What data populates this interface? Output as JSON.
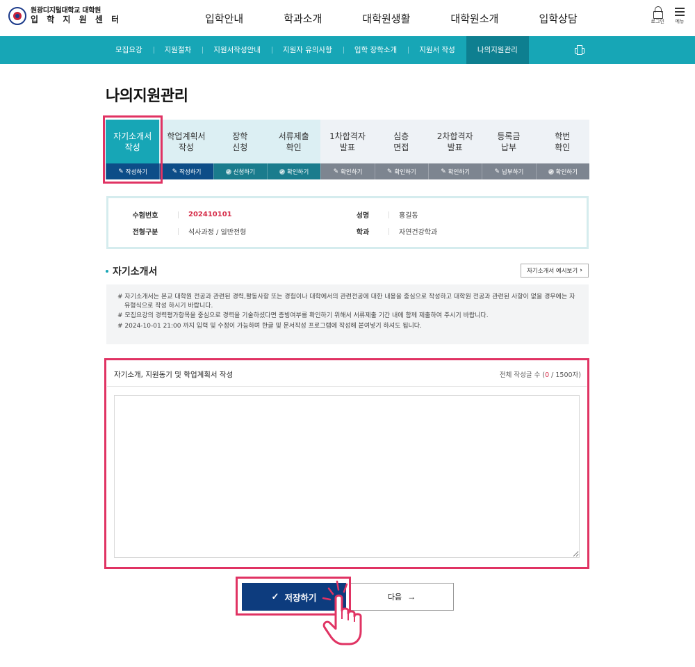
{
  "header": {
    "logo_line1": "원광디지털대학교 대학원",
    "logo_line2": "입 학 지 원 센 터",
    "gnb": [
      "입학안내",
      "학과소개",
      "대학원생활",
      "대학원소개",
      "입학상담"
    ],
    "login_label": "로그인",
    "menu_label": "메뉴"
  },
  "subnav": {
    "items": [
      "모집요강",
      "지원절차",
      "지원서작성안내",
      "지원자 유의사항",
      "입학 장학소개",
      "지원서 작성",
      "나의지원관리"
    ],
    "active_index": 6
  },
  "page_title": "나의지원관리",
  "steps": [
    {
      "line1": "자기소개서",
      "line2": "작성",
      "action": "작성하기",
      "icon": "pencil-icon",
      "state": "current"
    },
    {
      "line1": "학업계획서",
      "line2": "작성",
      "action": "작성하기",
      "icon": "pencil-icon",
      "state": "done"
    },
    {
      "line1": "장학",
      "line2": "신청",
      "action": "신청하기",
      "icon": "check-icon",
      "state": "done"
    },
    {
      "line1": "서류제출",
      "line2": "확인",
      "action": "확인하기",
      "icon": "check-icon",
      "state": "done"
    },
    {
      "line1": "1차합격자",
      "line2": "발표",
      "action": "확인하기",
      "icon": "pencil-icon",
      "state": "todo"
    },
    {
      "line1": "심층",
      "line2": "면접",
      "action": "확인하기",
      "icon": "pencil-icon",
      "state": "todo"
    },
    {
      "line1": "2차합격자",
      "line2": "발표",
      "action": "확인하기",
      "icon": "pencil-icon",
      "state": "todo"
    },
    {
      "line1": "등록금",
      "line2": "납부",
      "action": "납부하기",
      "icon": "pencil-icon",
      "state": "todo"
    },
    {
      "line1": "학번",
      "line2": "확인",
      "action": "확인하기",
      "icon": "check-icon",
      "state": "todo"
    }
  ],
  "info": {
    "exam_no_label": "수험번호",
    "exam_no": "202410101",
    "name_label": "성명",
    "name": "홍길동",
    "type_label": "전형구분",
    "type": "석사과정 / 일반전형",
    "dept_label": "학과",
    "dept": "자연건강학과"
  },
  "section": {
    "title": "자기소개서",
    "example_button": "자기소개서 예시보기"
  },
  "notice": [
    "# 자기소개서는 본교 대학원 전공과 관련된 경력,활동사항 또는 경험이나 대학에서의 관련전공에 대한 내용을 중심으로 작성하고 대학원 전공과 관련된 사항이 없을 경우에는 자유형식으로 작성 하시기 바랍니다.",
    "# 모집요강의 경력평가항목을 중심으로 경력을 기술하셨다면 증빙여부를 확인하기 위해서 서류제출 기간 내에 함께 제출하여 주시기 바랍니다.",
    "# 2024-10-01 21:00 까지 입력 및 수정이 가능하며 한글 및 문서작성 프로그램에 작성해 붙여넣기 하셔도 됩니다."
  ],
  "form": {
    "title": "자기소개, 지원동기 및 학업계획서 작성",
    "count_prefix": "전체 작성글 수 (",
    "count_value": "0",
    "count_suffix": " / 1500자)",
    "textarea_value": ""
  },
  "buttons": {
    "save": "저장하기",
    "next": "다음"
  },
  "colors": {
    "teal": "#17a6b6",
    "navy": "#0d3c7e",
    "highlight": "#e03363",
    "red_text": "#d62e4a"
  }
}
